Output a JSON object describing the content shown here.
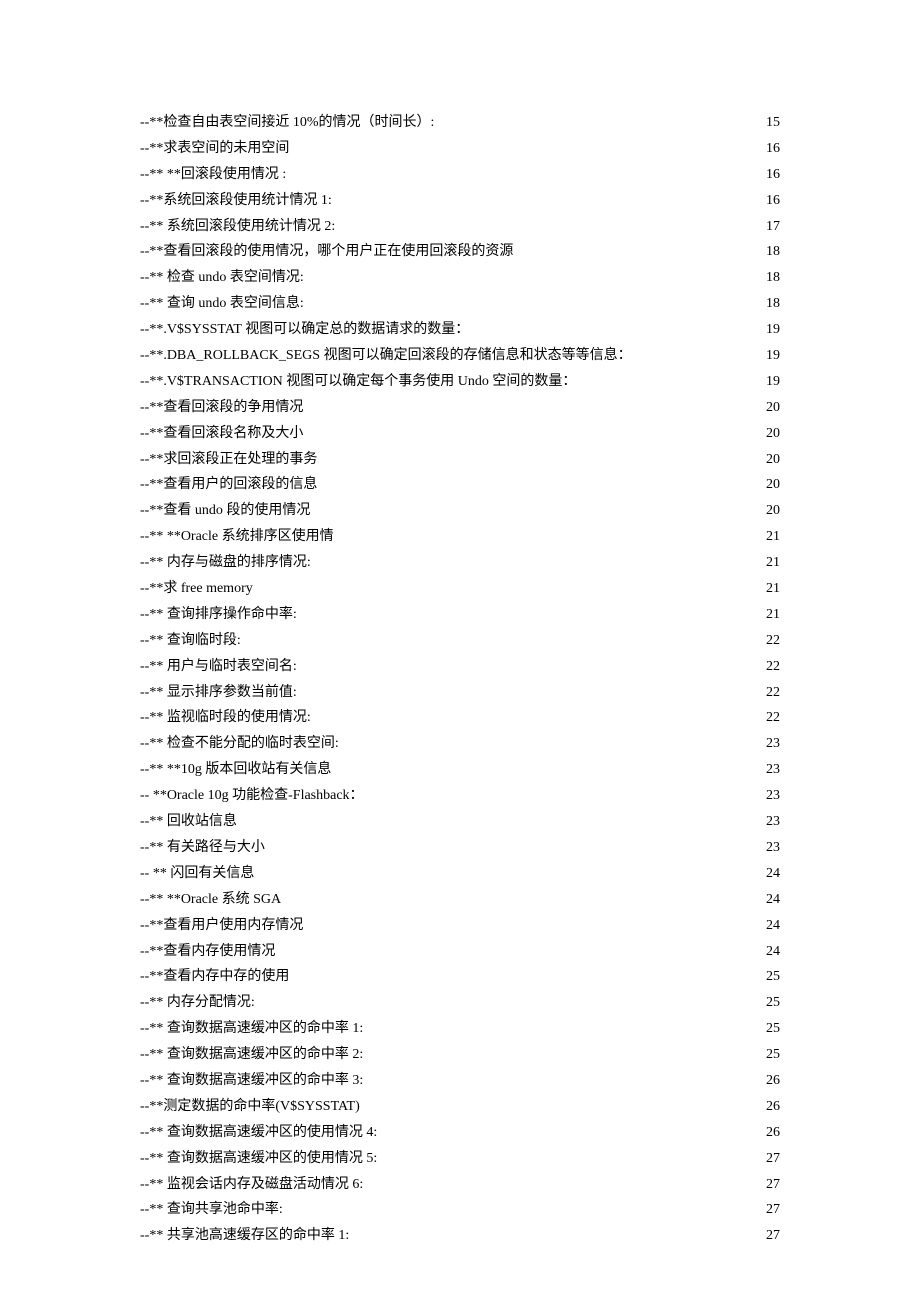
{
  "toc": [
    {
      "title": "--**检查自由表空间接近 10%的情况（时间长）:",
      "page": "15"
    },
    {
      "title": "--**求表空间的未用空间",
      "page": "16"
    },
    {
      "title": "--** **回滚段使用情况 :",
      "page": "16"
    },
    {
      "title": "--**系统回滚段使用统计情况 1:",
      "page": "16"
    },
    {
      "title": "--**  系统回滚段使用统计情况 2:",
      "page": "17"
    },
    {
      "title": "--**查看回滚段的使用情况，哪个用户正在使用回滚段的资源",
      "page": "18"
    },
    {
      "title": "--** 检查 undo 表空间情况:",
      "page": "18"
    },
    {
      "title": "--** 查询 undo 表空间信息:",
      "page": "18"
    },
    {
      "title": "--**.V$SYSSTAT 视图可以确定总的数据请求的数量：",
      "page": "19"
    },
    {
      "title": "--**.DBA_ROLLBACK_SEGS 视图可以确定回滚段的存储信息和状态等等信息：",
      "page": "19"
    },
    {
      "title": "--**.V$TRANSACTION 视图可以确定每个事务使用 Undo 空间的数量：",
      "page": "19"
    },
    {
      "title": "--**查看回滚段的争用情况",
      "page": "20"
    },
    {
      "title": "--**查看回滚段名称及大小",
      "page": "20"
    },
    {
      "title": "--**求回滚段正在处理的事务",
      "page": "20"
    },
    {
      "title": "--**查看用户的回滚段的信息",
      "page": "20"
    },
    {
      "title": "--**查看 undo 段的使用情况",
      "page": "20"
    },
    {
      "title": "--** **Oracle 系统排序区使用情",
      "page": "21"
    },
    {
      "title": "--** 内存与磁盘的排序情况:",
      "page": "21"
    },
    {
      "title": "--**求 free memory",
      "page": "21"
    },
    {
      "title": "--** 查询排序操作命中率:",
      "page": "21"
    },
    {
      "title": "--** 查询临时段:",
      "page": "22"
    },
    {
      "title": "--** 用户与临时表空间名:",
      "page": "22"
    },
    {
      "title": "--** 显示排序参数当前值:",
      "page": "22"
    },
    {
      "title": "--** 监视临时段的使用情况:",
      "page": "22"
    },
    {
      "title": "--** 检查不能分配的临时表空间:",
      "page": "23"
    },
    {
      "title": "--** **10g 版本回收站有关信息",
      "page": "23"
    },
    {
      "title": "-- **Oracle 10g 功能检查-Flashback：",
      "page": "23"
    },
    {
      "title": "--** 回收站信息",
      "page": "23"
    },
    {
      "title": "--** 有关路径与大小",
      "page": "23"
    },
    {
      "title": "-- ** 闪回有关信息",
      "page": "24"
    },
    {
      "title": "--** **Oracle 系统 SGA",
      "page": "24"
    },
    {
      "title": "--**查看用户使用内存情况",
      "page": "24"
    },
    {
      "title": "--**查看内存使用情况",
      "page": "24"
    },
    {
      "title": "--**查看内存中存的使用",
      "page": "25"
    },
    {
      "title": "--** 内存分配情况:",
      "page": "25"
    },
    {
      "title": "--** 查询数据高速缓冲区的命中率 1:",
      "page": "25"
    },
    {
      "title": "--** 查询数据高速缓冲区的命中率 2:",
      "page": "25"
    },
    {
      "title": "--** 查询数据高速缓冲区的命中率 3:",
      "page": "26"
    },
    {
      "title": "--**测定数据的命中率(V$SYSSTAT)",
      "page": "26"
    },
    {
      "title": "--** 查询数据高速缓冲区的使用情况 4:",
      "page": "26"
    },
    {
      "title": "--** 查询数据高速缓冲区的使用情况 5:",
      "page": "27"
    },
    {
      "title": "--** 监视会话内存及磁盘活动情况 6:",
      "page": "27"
    },
    {
      "title": "--** 查询共享池命中率:",
      "page": "27"
    },
    {
      "title": "--** 共享池高速缓存区的命中率 1:",
      "page": "27"
    }
  ]
}
